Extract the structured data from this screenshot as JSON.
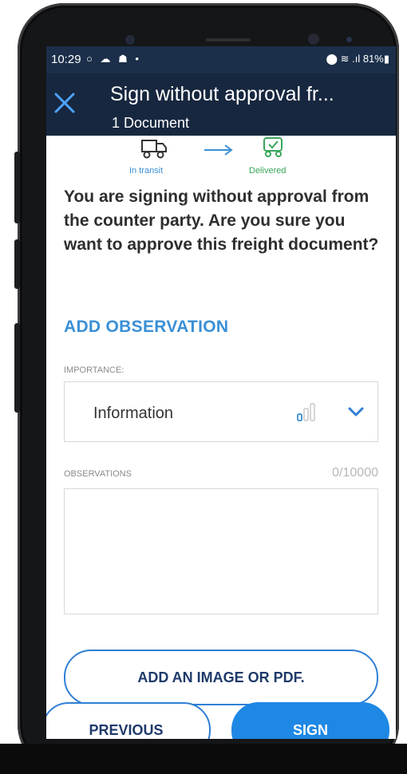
{
  "status_bar": {
    "time": "10:29",
    "left_icons": "○ ☁ ☗ •",
    "right_icons": "⬤ ≋ .ıl 81%▮"
  },
  "app_bar": {
    "title": "Sign without approval fr...",
    "subtitle": "1 Document"
  },
  "progress": {
    "step_from": "In transit",
    "step_to": "Delivered"
  },
  "question": "You are signing without approval from the counter party. Are you sure you want to approve this freight document?",
  "add_observation": "ADD OBSERVATION",
  "importance": {
    "label": "IMPORTANCE:",
    "value": "Information"
  },
  "observations": {
    "label": "OBSERVATIONS",
    "counter": "0/10000"
  },
  "buttons": {
    "add_image": "ADD AN IMAGE OR PDF.",
    "previous": "PREVIOUS",
    "sign": "SIGN"
  },
  "colors": {
    "app_bar": "#17273f",
    "accent": "#3a8fd6",
    "primary_button": "#1e88e5",
    "delivered": "#3aa65a"
  }
}
